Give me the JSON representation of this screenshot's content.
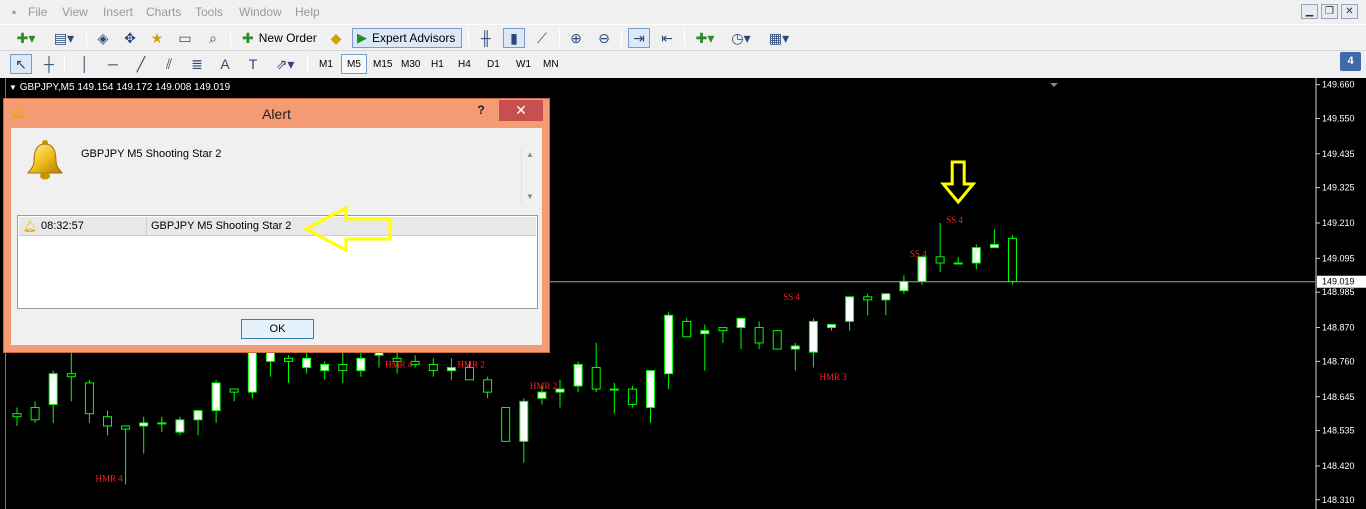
{
  "menu": {
    "items": [
      "File",
      "View",
      "Insert",
      "Charts",
      "Tools",
      "Window",
      "Help"
    ]
  },
  "toolbar": {
    "new_order": "New Order",
    "expert_advisors": "Expert Advisors",
    "notification_count": "4",
    "timeframes": [
      "M1",
      "M5",
      "M15",
      "M30",
      "H1",
      "H4",
      "D1",
      "W1",
      "MN"
    ],
    "active_timeframe": "M5"
  },
  "chart": {
    "header": "GBPJPY,M5  149.154 149.172 149.008 149.019",
    "current_price_label": "149.019",
    "background": "#000000",
    "bull_color": "#ffffff",
    "wick_color": "#00ff00",
    "annotation_color": "#ff2020",
    "arrow_color": "#ffff00"
  },
  "chart_data": {
    "type": "candlestick",
    "symbol": "GBPJPY",
    "timeframe": "M5",
    "ohlc_header": {
      "open": 149.154,
      "high": 149.172,
      "low": 149.008,
      "close": 149.019
    },
    "current_price": 149.019,
    "ylim": [
      148.28,
      149.675
    ],
    "y_ticks": [
      149.66,
      149.55,
      149.435,
      149.325,
      149.21,
      149.095,
      148.985,
      148.87,
      148.76,
      148.645,
      148.535,
      148.42,
      148.31
    ],
    "y_tick_labels": [
      "149.660",
      "149.550",
      "149.435",
      "149.325",
      "149.210",
      "149.095",
      "148.985",
      "148.870",
      "148.760",
      "148.645",
      "148.535",
      "148.420",
      "148.310"
    ],
    "candles": [
      [
        148.59,
        148.61,
        148.55,
        148.58
      ],
      [
        148.61,
        148.63,
        148.56,
        148.57
      ],
      [
        148.62,
        148.73,
        148.56,
        148.72
      ],
      [
        148.72,
        148.82,
        148.63,
        148.71
      ],
      [
        148.69,
        148.7,
        148.56,
        148.59
      ],
      [
        148.58,
        148.6,
        148.52,
        148.55
      ],
      [
        148.55,
        148.55,
        148.36,
        148.54
      ],
      [
        148.55,
        148.58,
        148.46,
        148.56
      ],
      [
        148.56,
        148.58,
        148.53,
        148.56
      ],
      [
        148.53,
        148.58,
        148.52,
        148.57
      ],
      [
        148.57,
        148.6,
        148.52,
        148.6
      ],
      [
        148.6,
        148.7,
        148.56,
        148.69
      ],
      [
        148.67,
        148.67,
        148.63,
        148.66
      ],
      [
        148.66,
        148.8,
        148.64,
        148.79
      ],
      [
        148.76,
        148.87,
        148.71,
        148.87
      ],
      [
        148.77,
        148.78,
        148.69,
        148.76
      ],
      [
        148.74,
        148.8,
        148.72,
        148.77
      ],
      [
        148.73,
        148.76,
        148.7,
        148.75
      ],
      [
        148.75,
        148.79,
        148.69,
        148.73
      ],
      [
        148.73,
        148.79,
        148.71,
        148.77
      ],
      [
        148.78,
        148.8,
        148.74,
        148.79
      ],
      [
        148.77,
        148.84,
        148.72,
        148.76
      ],
      [
        148.76,
        148.78,
        148.74,
        148.75
      ],
      [
        148.75,
        148.77,
        148.71,
        148.73
      ],
      [
        148.73,
        148.77,
        148.7,
        148.74
      ],
      [
        148.74,
        148.76,
        148.7,
        148.7
      ],
      [
        148.7,
        148.71,
        148.64,
        148.66
      ],
      [
        148.61,
        148.61,
        148.5,
        148.5
      ],
      [
        148.5,
        148.64,
        148.43,
        148.63
      ],
      [
        148.64,
        148.68,
        148.62,
        148.66
      ],
      [
        148.66,
        148.7,
        148.61,
        148.67
      ],
      [
        148.68,
        148.76,
        148.66,
        148.75
      ],
      [
        148.74,
        148.82,
        148.66,
        148.67
      ],
      [
        148.67,
        148.69,
        148.59,
        148.67
      ],
      [
        148.67,
        148.68,
        148.61,
        148.62
      ],
      [
        148.61,
        148.69,
        148.56,
        148.73
      ],
      [
        148.72,
        148.92,
        148.67,
        148.91
      ],
      [
        148.89,
        148.9,
        148.87,
        148.84
      ],
      [
        148.85,
        148.88,
        148.73,
        148.86
      ],
      [
        148.87,
        148.87,
        148.82,
        148.86
      ],
      [
        148.87,
        148.89,
        148.8,
        148.9
      ],
      [
        148.87,
        148.89,
        148.8,
        148.82
      ],
      [
        148.86,
        148.86,
        148.8,
        148.8
      ],
      [
        148.8,
        148.82,
        148.73,
        148.81
      ],
      [
        148.79,
        148.9,
        148.74,
        148.89
      ],
      [
        148.87,
        148.88,
        148.86,
        148.88
      ],
      [
        148.89,
        148.97,
        148.86,
        148.97
      ],
      [
        148.97,
        148.98,
        148.91,
        148.96
      ],
      [
        148.96,
        148.98,
        148.91,
        148.98
      ],
      [
        148.99,
        149.04,
        148.98,
        149.02
      ],
      [
        149.02,
        149.09,
        149.01,
        149.1
      ],
      [
        149.1,
        149.21,
        149.05,
        149.08
      ],
      [
        149.08,
        149.1,
        149.08,
        149.08
      ],
      [
        149.08,
        149.14,
        149.06,
        149.13
      ],
      [
        149.13,
        149.19,
        149.13,
        149.14
      ],
      [
        149.16,
        149.17,
        149.01,
        149.02
      ]
    ],
    "labels": [
      {
        "text": "HMR 4",
        "price": 148.37
      },
      {
        "text": "HMR 4",
        "price": 148.74
      },
      {
        "text": "HMR 2",
        "price": 148.74
      },
      {
        "text": "HMR 2",
        "price": 148.67
      },
      {
        "text": "SS 4",
        "price": 148.96
      },
      {
        "text": "HMR 3",
        "price": 148.7
      },
      {
        "text": "SS 4",
        "price": 149.1
      },
      {
        "text": "SS 4",
        "price": 149.21
      }
    ],
    "annotations": [
      "down arrow above SS 4 at 149.21",
      "left arrow pointing to alert list entry"
    ]
  },
  "dialog": {
    "title": "Alert",
    "help": "?",
    "close": "✕",
    "message": "GBPJPY M5 Shooting Star 2",
    "list": [
      {
        "time": "08:32:57",
        "message": "GBPJPY M5 Shooting Star 2"
      }
    ],
    "ok_label": "OK"
  }
}
